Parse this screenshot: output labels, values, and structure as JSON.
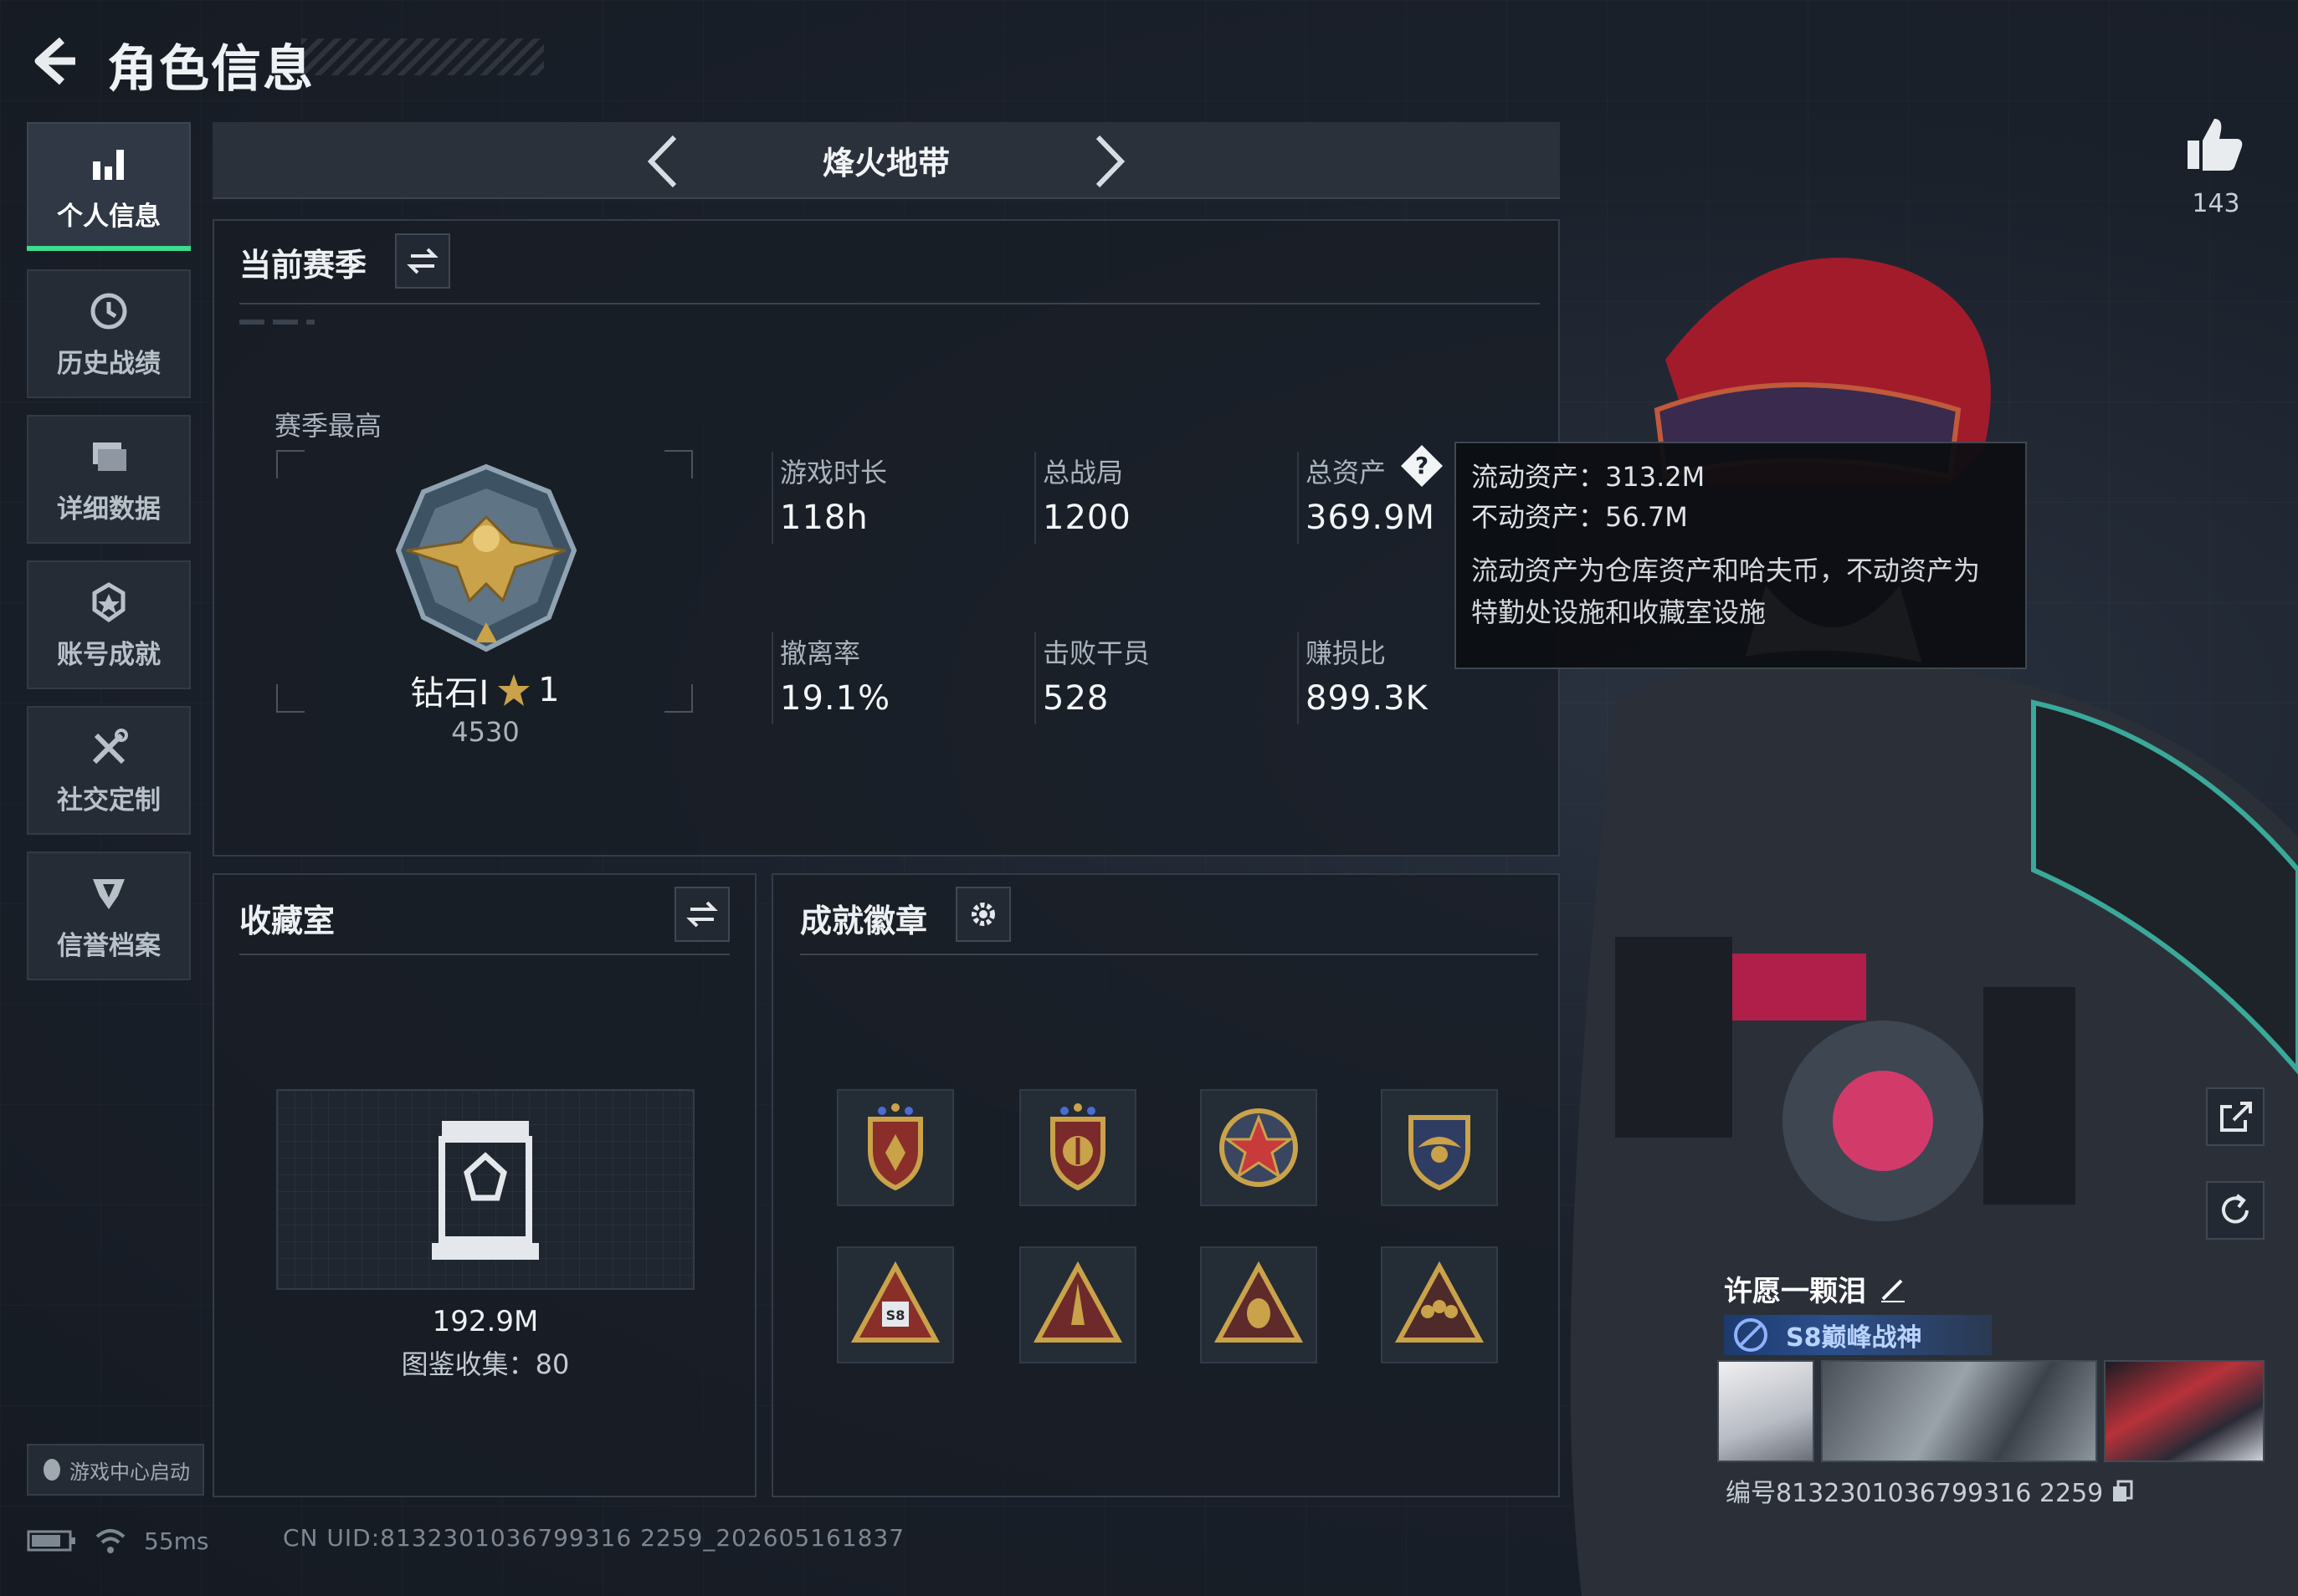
{
  "header": {
    "title": "角色信息"
  },
  "sidebar": {
    "items": [
      {
        "label": "个人信息",
        "icon": "bar-chart-icon",
        "active": true
      },
      {
        "label": "历史战绩",
        "icon": "history-clock-icon",
        "active": false
      },
      {
        "label": "详细数据",
        "icon": "folder-icon",
        "active": false
      },
      {
        "label": "账号成就",
        "icon": "medal-icon",
        "active": false
      },
      {
        "label": "社交定制",
        "icon": "tools-icon",
        "active": false
      },
      {
        "label": "信誉档案",
        "icon": "shield-emblem-icon",
        "active": false
      }
    ],
    "launch_button": "游戏中心启动"
  },
  "status": {
    "ping": "55ms",
    "uid": "CN UID:8132301036799316 2259_202605161837"
  },
  "mode": {
    "title": "烽火地带"
  },
  "season": {
    "title": "当前赛季",
    "best_label": "赛季最高",
    "rank_name": "钻石I",
    "rank_stars": "1",
    "rank_score": "4530",
    "stats": [
      {
        "label": "游戏时长",
        "value": "118h"
      },
      {
        "label": "总战局",
        "value": "1200"
      },
      {
        "label": "总资产",
        "value": "369.9M"
      },
      {
        "label": "撤离率",
        "value": "19.1%"
      },
      {
        "label": "击败干员",
        "value": "528"
      },
      {
        "label": "赚损比",
        "value": "899.3K"
      }
    ]
  },
  "tooltip": {
    "liquid": "流动资产：313.2M",
    "fixed": "不动资产：56.7M",
    "desc_line1": "流动资产为仓库资产和哈夫币，不动资产为",
    "desc_line2": "特勤处设施和收藏室设施"
  },
  "collection": {
    "title": "收藏室",
    "value": "192.9M",
    "catalog": "图鉴收集：80"
  },
  "badges": {
    "title": "成就徽章",
    "items": [
      "shield-badge-1",
      "shield-badge-2",
      "star-badge",
      "eagle-badge",
      "triangle-badge-s8",
      "triangle-badge-rocket",
      "triangle-badge-face",
      "triangle-badge-team"
    ]
  },
  "player": {
    "likes": "143",
    "name": "许愿一颗泪",
    "title_badge": "S8巅峰战神",
    "id": "编号8132301036799316 2259"
  },
  "colors": {
    "accent_green": "#3ddc8f",
    "gold": "#c9a24a",
    "bg": "#1b212b"
  }
}
